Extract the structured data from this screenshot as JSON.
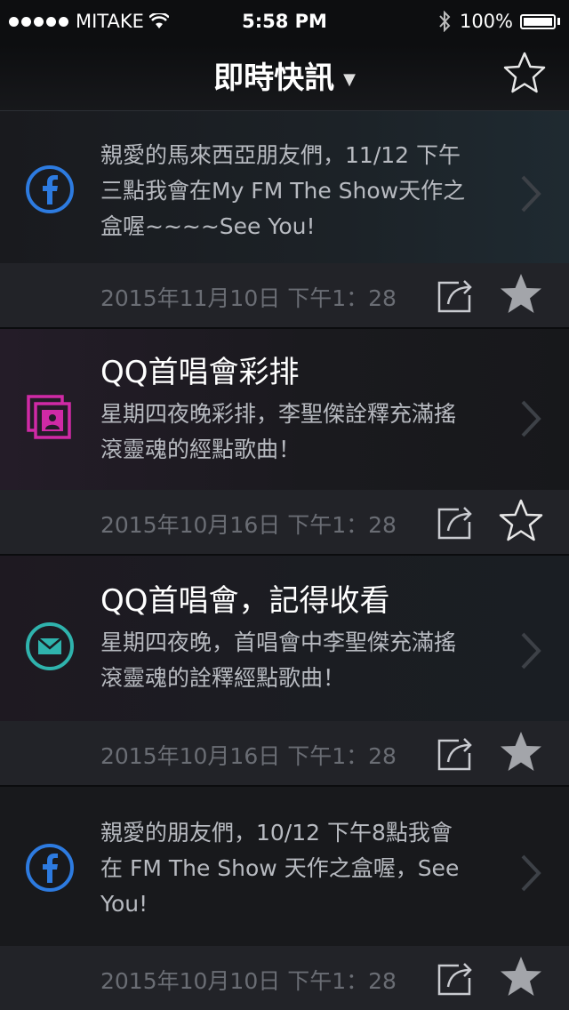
{
  "status_bar": {
    "carrier": "MITAKE",
    "time": "5:58 PM",
    "battery": "100%"
  },
  "nav": {
    "title": "即時快訊",
    "caret_icon": "caret-down-icon",
    "favorites_icon": "star-outline-icon"
  },
  "items": [
    {
      "icon": "facebook-icon",
      "title": "",
      "lines": [
        "親愛的馬來西亞朋友們，11/12 下午",
        "三點我會在My FM The Show天作之",
        "盒喔~~~~See You!"
      ],
      "date": "2015年11月10日 下午1：28",
      "starred": true
    },
    {
      "icon": "photo-icon",
      "title": "QQ首唱會彩排",
      "lines": [
        "星期四夜晚彩排，李聖傑詮釋充滿搖",
        "滾靈魂的經點歌曲！"
      ],
      "date": "2015年10月16日 下午1：28",
      "starred": false
    },
    {
      "icon": "mail-icon",
      "title": "QQ首唱會，記得收看",
      "lines": [
        "星期四夜晚，首唱會中李聖傑充滿搖",
        "滾靈魂的詮釋經點歌曲！"
      ],
      "date": "2015年10月16日 下午1：28",
      "starred": true
    },
    {
      "icon": "facebook-icon",
      "title": "",
      "lines": [
        "親愛的朋友們，10/12 下午8點我會",
        "在 FM The Show 天作之盒喔，See",
        "You!"
      ],
      "date": "2015年10月10日 下午1：28",
      "starred": true
    }
  ],
  "colors": {
    "facebook": "#2d7be0",
    "photo": "#d02aa6",
    "mail": "#2fb3ad",
    "star_filled": "#a3a5aa"
  }
}
